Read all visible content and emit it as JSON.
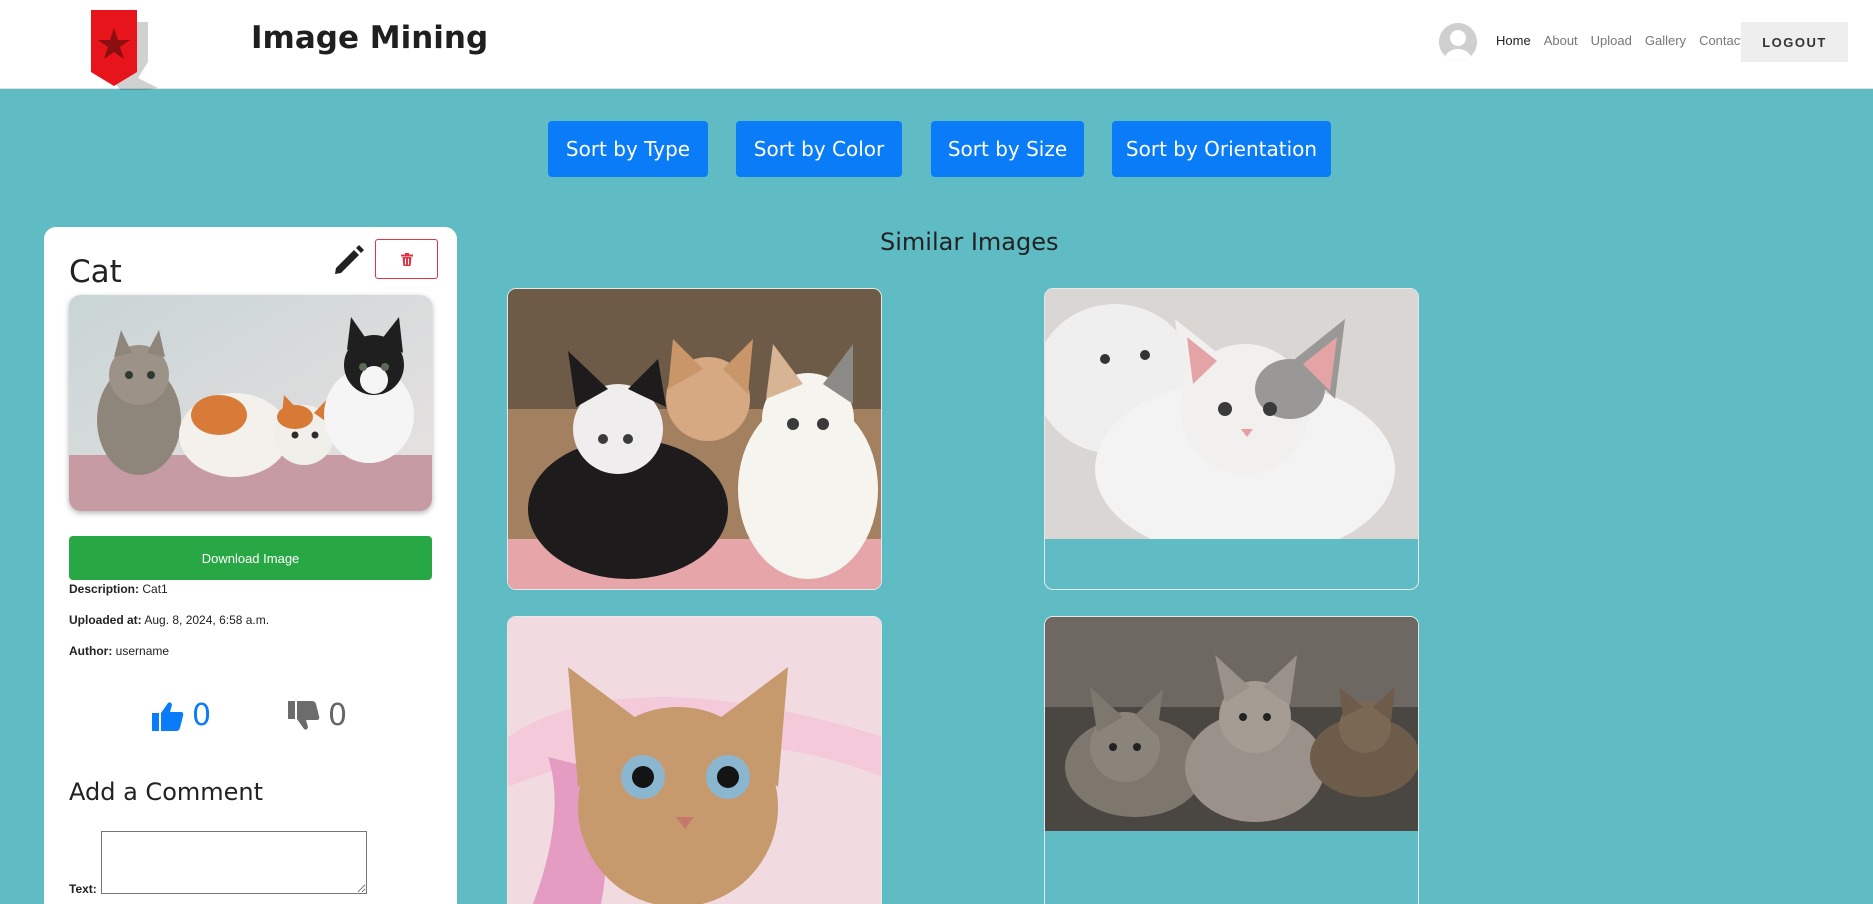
{
  "header": {
    "title": "Image Mining",
    "nav": [
      "Home",
      "About",
      "Upload",
      "Gallery",
      "Contact"
    ],
    "logout_label": "LOGOUT"
  },
  "sort_buttons": [
    "Sort by Type",
    "Sort by Color",
    "Sort by Size",
    "Sort by Orientation"
  ],
  "detail": {
    "title": "Cat",
    "download_label": "Download Image",
    "description_label": "Description:",
    "description_value": "Cat1",
    "uploaded_label": "Uploaded at:",
    "uploaded_value": "Aug. 8, 2024, 6:58 a.m.",
    "author_label": "Author:",
    "author_value": "username",
    "likes": "0",
    "dislikes": "0",
    "add_comment_heading": "Add a Comment",
    "text_label": "Text:"
  },
  "similar": {
    "heading": "Similar Images",
    "count": 4
  },
  "colors": {
    "background": "#5fbcc4",
    "primary": "#0a7cf8",
    "success": "#28a745",
    "danger": "#dc3545"
  }
}
